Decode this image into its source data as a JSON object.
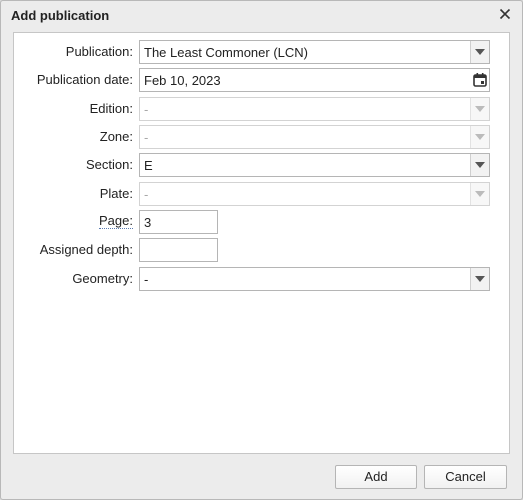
{
  "dialog": {
    "title": "Add publication"
  },
  "form": {
    "publication": {
      "label": "Publication:",
      "value": "The Least Commoner (LCN)"
    },
    "publication_date": {
      "label": "Publication date:",
      "value": "Feb 10, 2023"
    },
    "edition": {
      "label": "Edition:",
      "value": "-"
    },
    "zone": {
      "label": "Zone:",
      "value": "-"
    },
    "section": {
      "label": "Section:",
      "value": "E"
    },
    "plate": {
      "label": "Plate:",
      "value": "-"
    },
    "page": {
      "label": "Page:",
      "value": "3"
    },
    "assigned_depth": {
      "label": "Assigned depth:",
      "value": ""
    },
    "geometry": {
      "label": "Geometry:",
      "value": "-"
    }
  },
  "buttons": {
    "add": "Add",
    "cancel": "Cancel"
  },
  "icons": {
    "close": "close-icon",
    "calendar": "calendar-icon",
    "dropdown": "chevron-down-icon"
  }
}
